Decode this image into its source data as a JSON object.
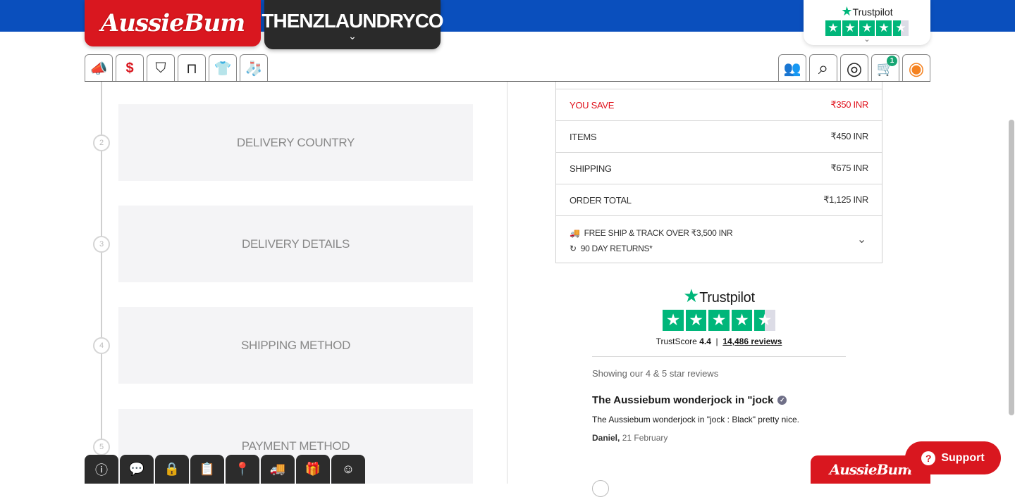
{
  "header": {
    "brand_aussiebum": "AussieBum",
    "brand_laundry": "THENZLAUNDRYCO",
    "brand_laundry_chevron": "⌄",
    "trustpilot_label": "Trustpilot",
    "trustpilot_rating": 4.5
  },
  "nav_left": [
    {
      "name": "promo-megaphone-icon",
      "glyph": "📣"
    },
    {
      "name": "sale-tag-icon",
      "glyph": "$"
    },
    {
      "name": "briefs-icon",
      "glyph": "⛉"
    },
    {
      "name": "trunks-icon",
      "glyph": "⊓"
    },
    {
      "name": "tshirt-icon",
      "glyph": "👕"
    },
    {
      "name": "socks-icon",
      "glyph": "🧦"
    }
  ],
  "nav_right": {
    "community_glyph": "👥",
    "search_glyph": "⌕",
    "account_glyph": "◎",
    "cart_glyph": "🛒",
    "cart_count": "1",
    "country_glyph": "◉"
  },
  "steps": [
    {
      "num": "2",
      "label": "DELIVERY COUNTRY"
    },
    {
      "num": "3",
      "label": "DELIVERY DETAILS"
    },
    {
      "num": "4",
      "label": "SHIPPING METHOD"
    },
    {
      "num": "5",
      "label": "PAYMENT METHOD"
    }
  ],
  "summary": {
    "rows": [
      {
        "label": "YOU SAVE",
        "value": "₹350 INR"
      },
      {
        "label": "ITEMS",
        "value": "₹450 INR"
      },
      {
        "label": "SHIPPING",
        "value": "₹675 INR"
      },
      {
        "label": "ORDER TOTAL",
        "value": "₹1,125 INR"
      }
    ],
    "perk_ship": "FREE SHIP & TRACK OVER ₹3,500 INR",
    "perk_returns": "90 DAY RETURNS*",
    "perk_ship_glyph": "🚚",
    "perk_returns_glyph": "↻",
    "perks_chevron": "⌄"
  },
  "trustpilot": {
    "logo": "Trustpilot",
    "rating": 4.5,
    "score_label": "TrustScore",
    "score": "4.4",
    "reviews_link": "14,486 reviews",
    "showing": "Showing our 4 & 5 star reviews",
    "review_title": "The Aussiebum wonderjock in \"jock",
    "review_body": "The Aussiebum wonderjock in \"jock : Black\" pretty nice.",
    "review_author": "Daniel,",
    "review_date": "21 February"
  },
  "bottom_bar": [
    {
      "name": "info-icon",
      "glyph": "ⓘ"
    },
    {
      "name": "faq-icon",
      "glyph": "💬"
    },
    {
      "name": "privacy-icon",
      "glyph": "🔒"
    },
    {
      "name": "terms-icon",
      "glyph": "📋"
    },
    {
      "name": "location-icon",
      "glyph": "📍"
    },
    {
      "name": "shipping-truck-icon",
      "glyph": "🚚"
    },
    {
      "name": "gift-card-icon",
      "glyph": "🎁"
    },
    {
      "name": "customer-support-icon",
      "glyph": "☺"
    }
  ],
  "support": {
    "label": "Support",
    "glyph": "?"
  },
  "footer_brand": "AussieBum",
  "colors": {
    "brand_red": "#d9171f",
    "top_blue": "#0a4fbd",
    "trustpilot_green": "#00b67a",
    "save_red": "#e0141e"
  }
}
